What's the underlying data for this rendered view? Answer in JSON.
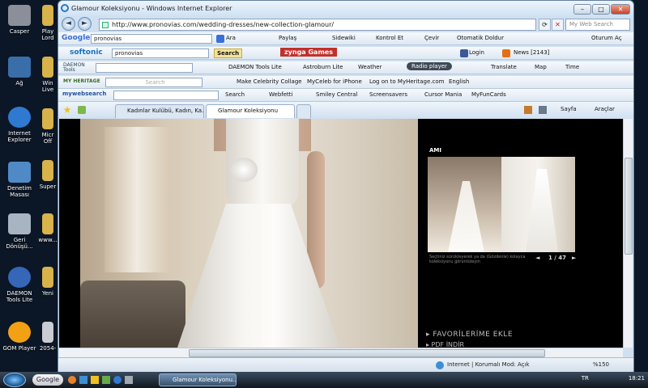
{
  "desktop": {
    "icons": [
      {
        "label": "Casper"
      },
      {
        "label": "Ağ"
      },
      {
        "label": "Internet Explorer"
      },
      {
        "label": "Denetim Masası"
      },
      {
        "label": "Geri Dönüşü..."
      },
      {
        "label": "DAEMON Tools Lite"
      },
      {
        "label": "GOM Player"
      }
    ],
    "icons_col2": [
      {
        "label": "Play Lord"
      },
      {
        "label": "Win Live"
      },
      {
        "label": "Micr Off"
      },
      {
        "label": "Super"
      },
      {
        "label": "www..."
      },
      {
        "label": "Yeni"
      },
      {
        "label": "2054-"
      }
    ]
  },
  "window": {
    "title": "Glamour Koleksiyonu - Windows Internet Explorer",
    "min": "–",
    "max": "□",
    "close": "✕"
  },
  "address_bar": {
    "url": "http://www.pronovias.com/wedding-dresses/new-collection-glamour/",
    "search_placeholder": "My Web Search",
    "back": "◄",
    "forward": "►"
  },
  "toolbars": {
    "google": {
      "logo": "Google",
      "query": "pronovias",
      "items": [
        "Ara",
        "Paylaş",
        "Sidewiki",
        "Kontrol Et",
        "Çevir",
        "Otomatik Doldur",
        "Oturum Aç"
      ]
    },
    "softonic": {
      "logo": "softonic",
      "query": "pronovias",
      "search": "Search",
      "zynga": "zynga Games",
      "login": "Login",
      "news": "News [2143]"
    },
    "daemon": {
      "logo": "DAEMON Tools",
      "items": [
        "DAEMON Tools Lite",
        "Astroburn Lite",
        "Weather",
        "Radio player",
        "Translate",
        "Map",
        "Time"
      ]
    },
    "myheritage": {
      "logo": "MY HERITAGE",
      "search_placeholder": "Search",
      "items": [
        "Make Celebrity Collage",
        "MyCeleb for iPhone",
        "Log on to MyHeritage.com",
        "English"
      ]
    },
    "mywebsearch": {
      "logo": "mywebsearch",
      "search": "Search",
      "items": [
        "Webfetti",
        "Smiley Central",
        "Screensavers",
        "Cursor Mania",
        "MyFunCards"
      ]
    }
  },
  "tabs": [
    {
      "label": "Kadınlar Kulübü, Kadın, Ka..."
    },
    {
      "label": "Glamour Koleksiyonu"
    }
  ],
  "command_bar": {
    "page": "Sayfa",
    "tools": "Araçlar"
  },
  "page": {
    "model_name": "AMI",
    "caption": "Seçtiniz sürükleyerek ya da (Gözdenle) kolayca koleksiyonu görüntüleyin",
    "counter": "1 / 47",
    "prev": "◄",
    "next": "►",
    "favorites": "▸ FAVORİLERİME EKLE",
    "pdf": "▸ PDF İNDİR"
  },
  "status": {
    "zone": "Internet | Korumalı Mod: Açık",
    "zoom": "%150"
  },
  "taskbar": {
    "google": "Google",
    "task": "Glamour Koleksiyonu...",
    "lang": "TR",
    "time": "18:21"
  }
}
